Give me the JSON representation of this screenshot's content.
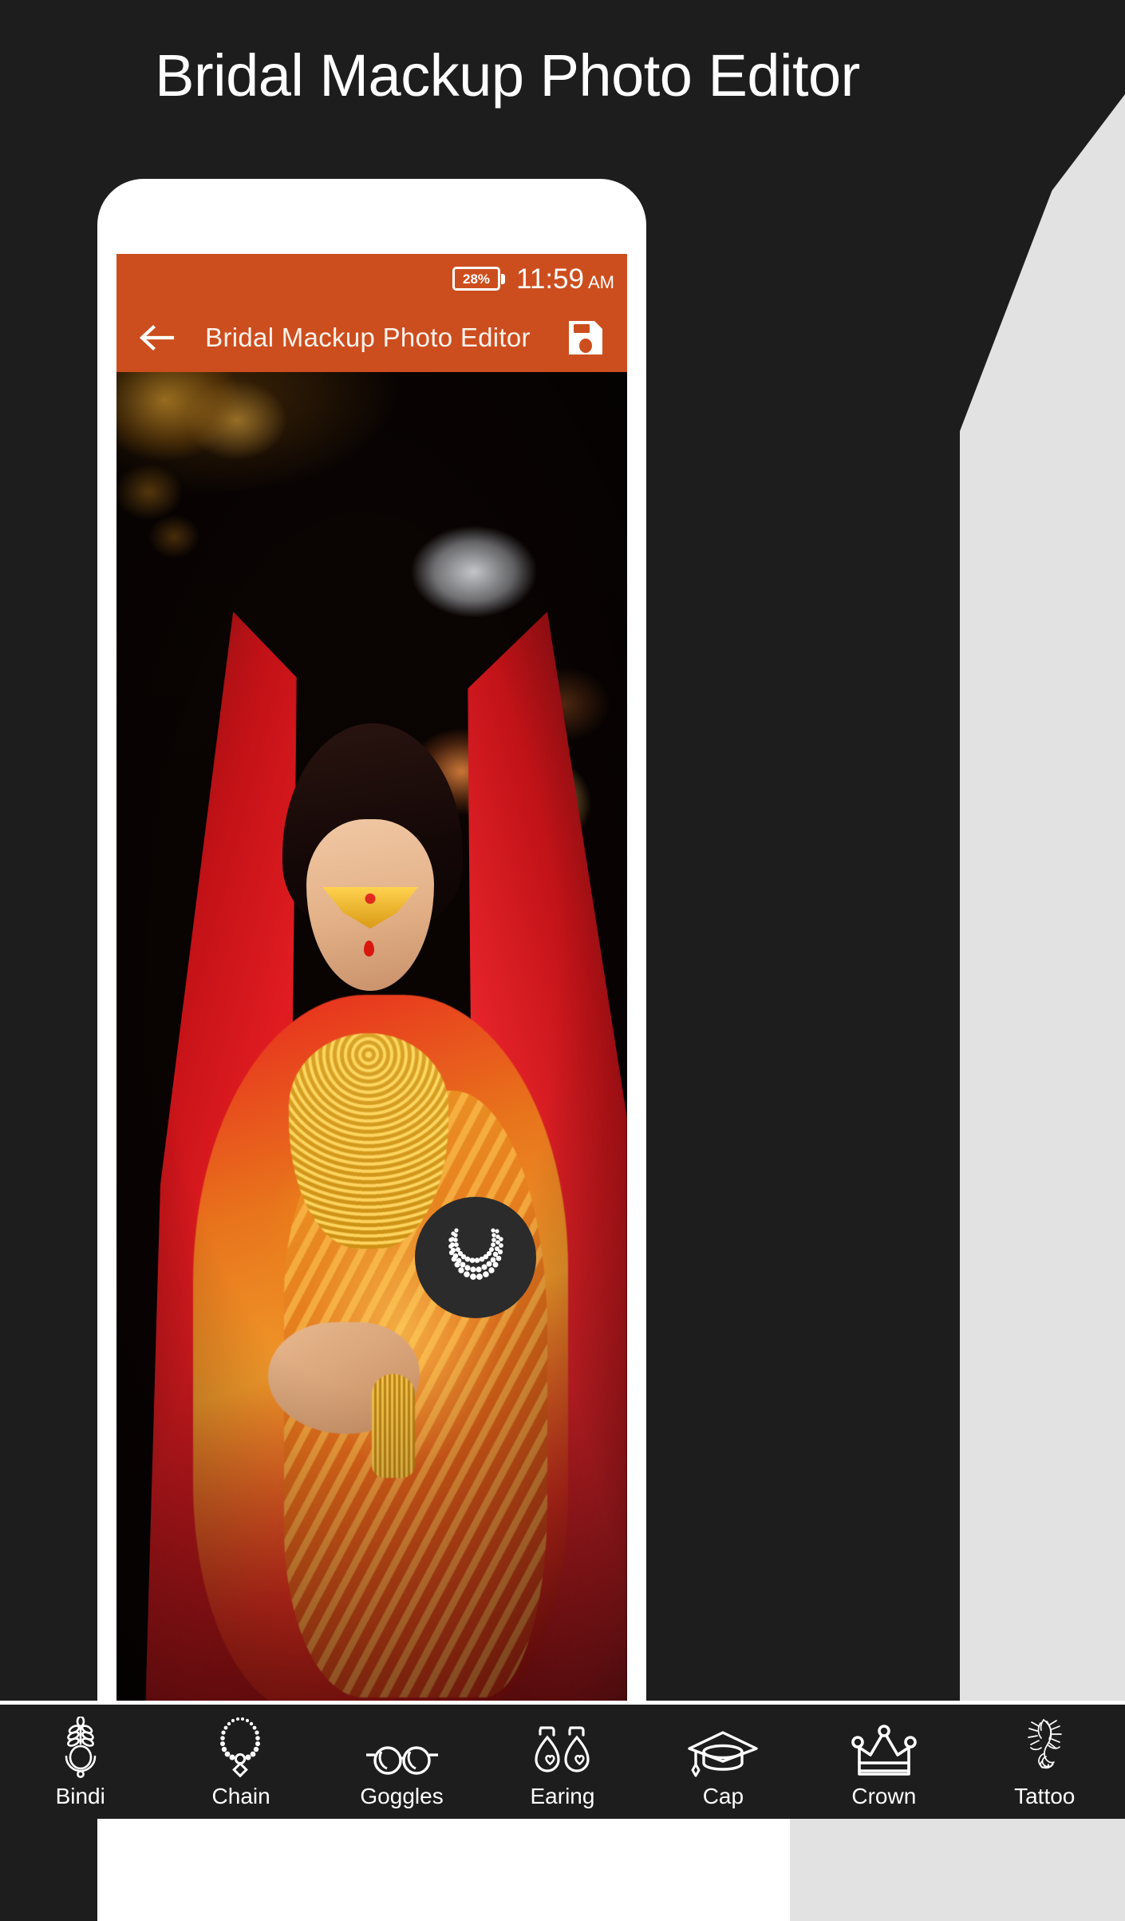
{
  "hero": {
    "title": "Bridal Mackup Photo Editor"
  },
  "phone": {
    "status_bar": {
      "battery_percent": "28%",
      "time": "11:59",
      "ampm": "AM"
    },
    "app_bar": {
      "back_icon": "back-arrow-icon",
      "title": "Bridal Mackup Photo Editor",
      "save_icon": "save-floppy-icon"
    },
    "canvas": {
      "fab_icon": "necklace-icon"
    }
  },
  "toolbar": {
    "items": [
      {
        "label": "Bindi",
        "icon": "bindi-icon"
      },
      {
        "label": "Chain",
        "icon": "chain-icon"
      },
      {
        "label": "Goggles",
        "icon": "goggles-icon"
      },
      {
        "label": "Earing",
        "icon": "earring-icon"
      },
      {
        "label": "Cap",
        "icon": "cap-icon"
      },
      {
        "label": "Crown",
        "icon": "crown-icon"
      },
      {
        "label": "Tattoo",
        "icon": "tattoo-icon"
      }
    ]
  },
  "colors": {
    "accent_orange": "#cc4e1e",
    "background_dark": "#1d1d1d",
    "panel_gray": "#e2e2e2",
    "text_white": "#ffffff"
  }
}
